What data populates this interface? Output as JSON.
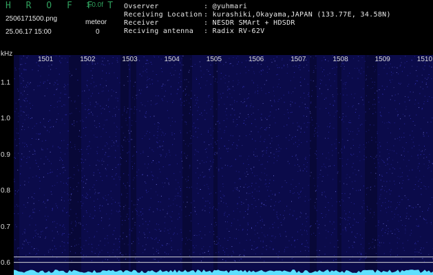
{
  "header": {
    "app_title": "H R O F F T",
    "version": "1.0.0f",
    "filename": "2506171500.png",
    "datetime": "25.06.17 15:00",
    "meteor_label": "meteor",
    "meteor_count": "0"
  },
  "info": {
    "rows": [
      {
        "label": "Ovserver",
        "value": ": @yuhmari"
      },
      {
        "label": "Receiving Location",
        "value": ": kurashiki,Okayama,JAPAN (133.77E, 34.58N)"
      },
      {
        "label": "Receiver",
        "value": ": NESDR SMArt + HDSDR"
      },
      {
        "label": "Reciving antenna",
        "value": ": Radix RV-62V"
      }
    ]
  },
  "chart_data": {
    "type": "heatmap",
    "ylabel": "kHz",
    "y_ticks": [
      "1.1",
      "1.0",
      "0.9",
      "0.8",
      "0.7",
      "0.6"
    ],
    "x_ticks": [
      "1501",
      "1502",
      "1503",
      "1504",
      "1505",
      "1506",
      "1507",
      "1508",
      "1509",
      "1510"
    ],
    "ylim": [
      0.57,
      1.18
    ],
    "horizontal_lines_khz": [
      0.62,
      0.605
    ],
    "colors": {
      "background": "#0b0b4a",
      "noise": "#3b3bd0",
      "band": "#5ee0ff",
      "line": "#d8d8d8"
    }
  }
}
